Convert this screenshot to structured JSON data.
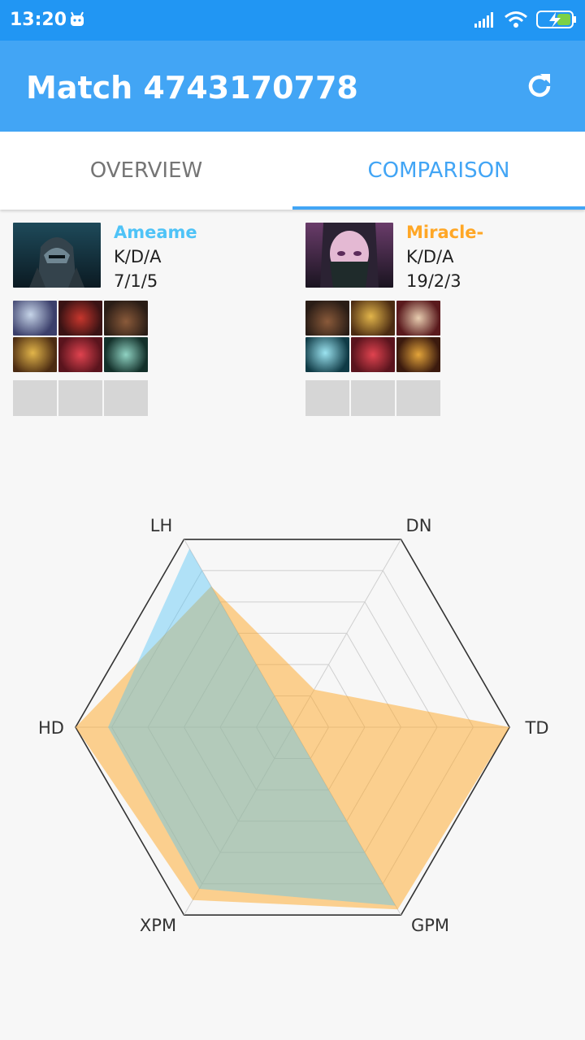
{
  "status_bar": {
    "time": "13:20"
  },
  "app_bar": {
    "title": "Match 4743170778"
  },
  "tabs": [
    {
      "label": "OVERVIEW"
    },
    {
      "label": "COMPARISON"
    }
  ],
  "active_tab": "COMPARISON",
  "players": [
    {
      "name": "Ameame",
      "color": "#4fc3f7",
      "kda_label": "K/D/A",
      "kda": "7/1/5",
      "hero_icon": "phantom-assassin-portrait",
      "items": [
        "item-icon-1",
        "item-icon-2",
        "boots-icon",
        "helm-icon",
        "crimson-blade-icon",
        "dagger-icon"
      ],
      "backpack_slots": 3
    },
    {
      "name": "Miracle-",
      "color": "#ffa726",
      "kda_label": "K/D/A",
      "kda": "19/2/3",
      "hero_icon": "templar-assassin-portrait",
      "items": [
        "boots-icon",
        "helm-icon",
        "staff-icon",
        "axe-icon",
        "crimson-blade-icon",
        "scepter-icon"
      ],
      "backpack_slots": 3
    }
  ],
  "radar": {
    "axes": [
      "LH",
      "DN",
      "TD",
      "GPM",
      "XPM",
      "HD"
    ],
    "series": [
      {
        "name": "Ameame",
        "color": "#4fc3f7",
        "values": [
          0.95,
          0.0,
          0.0,
          0.95,
          0.86,
          0.85
        ]
      },
      {
        "name": "Miracle-",
        "color": "#ffa726",
        "values": [
          0.75,
          0.2,
          1.0,
          0.97,
          0.92,
          1.0
        ]
      }
    ]
  }
}
